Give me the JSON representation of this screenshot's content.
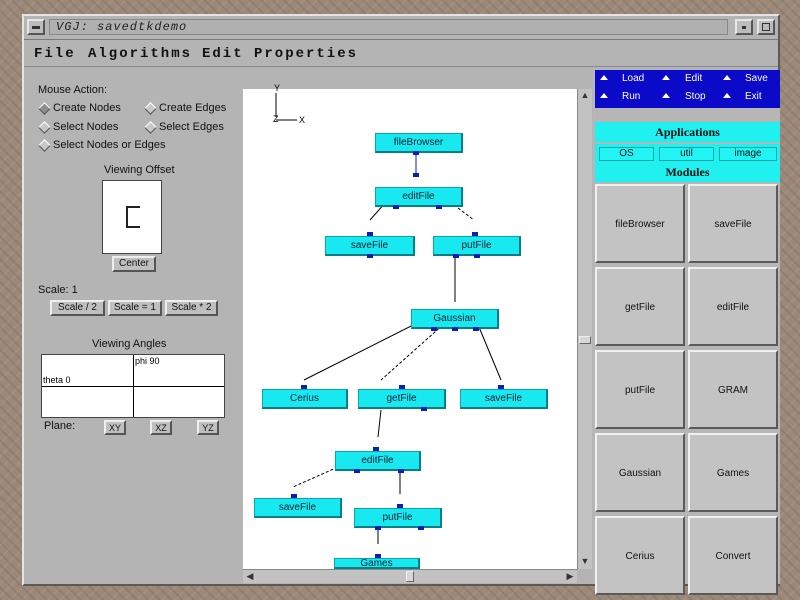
{
  "window": {
    "title": "VGJ: savedtkdemo"
  },
  "menu": [
    "File",
    "Algorithms",
    "Edit",
    "Properties"
  ],
  "left": {
    "mouse_action_label": "Mouse Action:",
    "options": [
      "Create Nodes",
      "Create Edges",
      "Select Nodes",
      "Select Edges",
      "Select Nodes or Edges"
    ],
    "viewing_offset_label": "Viewing Offset",
    "center_label": "Center",
    "scale_label": "Scale: 1",
    "scale_buttons": [
      "Scale / 2",
      "Scale = 1",
      "Scale * 2"
    ],
    "viewing_angles_label": "Viewing Angles",
    "phi_label": "phi 90",
    "theta_label": "theta 0",
    "plane_label": "Plane:",
    "plane_buttons": [
      "XY",
      "XZ",
      "YZ"
    ]
  },
  "canvas": {
    "axis": {
      "y": "Y",
      "z": "Z",
      "x": "X"
    },
    "nodes": [
      "fileBrowser",
      "editFile",
      "saveFile",
      "putFile",
      "Gaussian",
      "Cerius",
      "getFile",
      "saveFile",
      "editFile",
      "saveFile",
      "putFile",
      "Games"
    ]
  },
  "right": {
    "controls": [
      "Load",
      "Edit",
      "Save",
      "Run",
      "Stop",
      "Exit"
    ],
    "applications_label": "Applications",
    "app_buttons": [
      "OS",
      "util",
      "image"
    ],
    "modules_label": "Modules",
    "modules": [
      "fileBrowser",
      "saveFile",
      "getFile",
      "editFile",
      "putFile",
      "GRAM",
      "Gaussian",
      "Games",
      "Cerius",
      "Convert"
    ]
  },
  "colors": {
    "node_fill": "#18e8f0",
    "port": "#0a1fb4",
    "control_strip": "#0a0ac8",
    "header_cyan": "#20f0f0"
  }
}
